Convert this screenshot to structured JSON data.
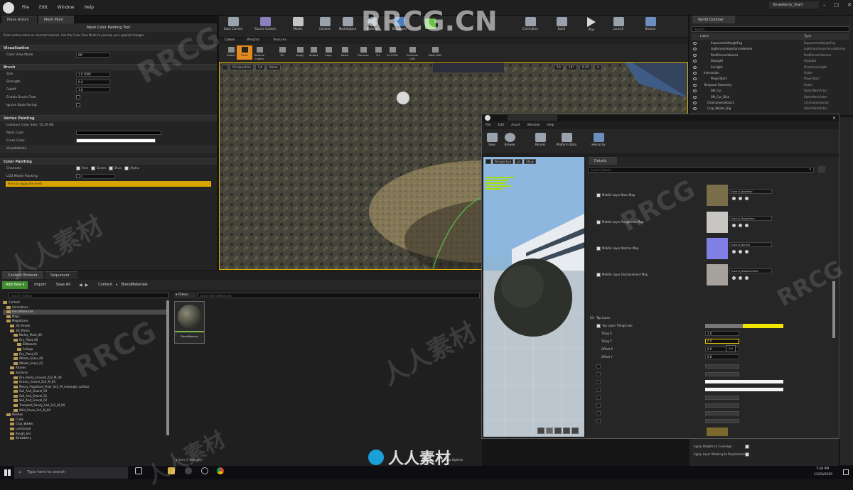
{
  "menubar": {
    "items": [
      "File",
      "Edit",
      "Window",
      "Help"
    ],
    "project": "Strawberry_Start"
  },
  "left_tabs": [
    "Place Actors",
    "Mesh Paint"
  ],
  "toolbar": {
    "buttons": [
      "Save Current",
      "Source Control",
      "Modes",
      "Content",
      "Marketplace",
      "Settings",
      "Blueprints",
      "Cinematics",
      "Build",
      "Play",
      "Launch",
      "Browse"
    ]
  },
  "mesh_paint": {
    "title": "Mesh Color Painting Tool",
    "hint": "Paint vertex colors on selected meshes. Use the Color View Mode to preview your applied changes.",
    "mode_tabs": [
      "Colors",
      "Weights",
      "Textures"
    ],
    "mode_tools": [
      "Select",
      "Paint",
      "Reduce Colors",
      "Fill",
      "Apply",
      "Import",
      "Copy",
      "Paste",
      "Remove",
      "Fix",
      "All LODs",
      "Previous LOD",
      "Next LOD"
    ],
    "sections": {
      "visualization": {
        "label": "Visualization",
        "color_view_mode_label": "Color View Mode",
        "color_view_mode_value": "Off"
      },
      "brush": {
        "label": "Brush",
        "size_label": "Size",
        "size_value": "1.0 1000",
        "strength_label": "Strength",
        "strength_value": "0.4",
        "falloff_label": "Falloff",
        "falloff_value": "1.0",
        "flow_label": "Enable Brush Flow",
        "backface_label": "Ignore Back-Facing"
      },
      "vertex": {
        "label": "Vertex Painting",
        "instance_label": "Instance Color Size: 15.19 KB",
        "paint_color_label": "Paint Color",
        "erase_color_label": "Erase Color",
        "visualization_label": "Visualization"
      },
      "color": {
        "label": "Color Painting",
        "channels_label": "Channels",
        "channels": [
          "Red",
          "Green",
          "Blue",
          "Alpha"
        ],
        "lod_label": "LOD Model Painting",
        "warning": "Press to Apply the mesh"
      }
    }
  },
  "viewport": {
    "buttons": [
      "Perspective",
      "Lit",
      "Show"
    ],
    "snap_values": [
      "10",
      "10°",
      "0.25",
      "4"
    ]
  },
  "outliner": {
    "title": "World Outliner",
    "search_placeholder": "Search...",
    "col_label": "Label",
    "col_type": "Type",
    "items": [
      {
        "name": "ExponentialHeightFog",
        "type": "ExponentialHeightFog",
        "indent": 3
      },
      {
        "name": "LightmassImportanceVolume",
        "type": "LightmassImportanceVolume",
        "indent": 3
      },
      {
        "name": "PostProcessVolume",
        "type": "PostProcessVolume",
        "indent": 3
      },
      {
        "name": "SkyLight",
        "type": "SkyLight",
        "indent": 3
      },
      {
        "name": "Sunlight",
        "type": "DirectionalLight",
        "indent": 3
      },
      {
        "name": "Interaction",
        "type": "Folder",
        "indent": 1
      },
      {
        "name": "PlayerStart",
        "type": "PlayerStart",
        "indent": 3
      },
      {
        "name": "Temporal Geometry",
        "type": "Folder",
        "indent": 1
      },
      {
        "name": "SM_Cyc",
        "type": "StaticMeshActor",
        "indent": 3
      },
      {
        "name": "SM_Cyc_Disk",
        "type": "StaticMeshActor",
        "indent": 3
      },
      {
        "name": "CineCameraActor1",
        "type": "CineCameraActor",
        "indent": 2
      },
      {
        "name": "Crop_Walker_Big",
        "type": "StaticMeshActor",
        "indent": 2
      }
    ]
  },
  "content_browser": {
    "tabs": [
      "Content Browser",
      "Sequencer"
    ],
    "add_new": "Add New",
    "import": "Import",
    "save_all": "Save All",
    "path": [
      "Content",
      "BlendMaterials"
    ],
    "filters": "Filters",
    "search_placeholder": "Search BlendMaterials",
    "tree_search_placeholder": "Search Folders",
    "tree": [
      {
        "name": "Content",
        "indent": 0
      },
      {
        "name": "Animations",
        "indent": 1
      },
      {
        "name": "BlendMaterials",
        "indent": 1
      },
      {
        "name": "Maps",
        "indent": 1
      },
      {
        "name": "MegaScans",
        "indent": 1
      },
      {
        "name": "3D_Assets",
        "indent": 2
      },
      {
        "name": "3D_Plants",
        "indent": 2
      },
      {
        "name": "Barley_Plant_00",
        "indent": 3
      },
      {
        "name": "Dry_Plant_00",
        "indent": 3
      },
      {
        "name": "Billboards",
        "indent": 4
      },
      {
        "name": "Foliage",
        "indent": 4
      },
      {
        "name": "Dry_Plant_01",
        "indent": 3
      },
      {
        "name": "Wheat_Grass_00",
        "indent": 3
      },
      {
        "name": "Wheat_Grass_01",
        "indent": 3
      },
      {
        "name": "Atlases",
        "indent": 2
      },
      {
        "name": "Surfaces",
        "indent": 2
      },
      {
        "name": "Dry_Rocky_Ground_2x2_M_00",
        "indent": 3
      },
      {
        "name": "Grassy_Gravel_2x2_M_00",
        "indent": 3
      },
      {
        "name": "Mossy_Flagstone_Floor_2x2_M_rectangle_surface",
        "indent": 3
      },
      {
        "name": "Soil_And_Gravel_00",
        "indent": 3
      },
      {
        "name": "Soil_And_Gravel_01",
        "indent": 3
      },
      {
        "name": "Soil_And_Gravel_02",
        "indent": 3
      },
      {
        "name": "Trampled_Sandy_Soil_2x2_M_00",
        "indent": 3
      },
      {
        "name": "Wild_Grass_2x2_M_00",
        "indent": 3
      },
      {
        "name": "Meshes",
        "indent": 1
      },
      {
        "name": "Crate",
        "indent": 2
      },
      {
        "name": "Crop_Walker",
        "indent": 2
      },
      {
        "name": "Landscape",
        "indent": 2
      },
      {
        "name": "Rough_Set",
        "indent": 2
      },
      {
        "name": "Strawberry",
        "indent": 2
      }
    ],
    "asset_name": "BlendMaterial",
    "status": "1 item (1 selected)",
    "view_options": "View Options"
  },
  "material_editor": {
    "menu": [
      "File",
      "Edit",
      "Asset",
      "Window",
      "Help"
    ],
    "toolbar": [
      "Save",
      "Browse",
      "Params",
      "Platform Stats",
      "Hierarchy"
    ],
    "preview_buttons": [
      "Perspective",
      "Lit",
      "Show"
    ],
    "details_tab": "Details",
    "details_search_placeholder": "Search Details",
    "textures": [
      {
        "label": "Middle Layer Base Map",
        "name": "Ground_BaseMap"
      },
      {
        "label": "Middle Layer Roughness Map",
        "name": "Ground_Roughness"
      },
      {
        "label": "Middle Layer Normal Map",
        "name": "Ground_Normal"
      },
      {
        "label": "Middle Layer Displacement Map",
        "name": "Ground_Displacement"
      }
    ],
    "top_layer_group": "03 - Top Layer",
    "top_layer_tint": "Top Layer Tiling/Color",
    "tiling": [
      {
        "label": "Tiling X",
        "value": "1.0"
      },
      {
        "label": "Tiling Y",
        "value": "0.5"
      },
      {
        "label": "Offset X",
        "value": "0.0"
      },
      {
        "label": "Offset Y",
        "value": "0.0"
      }
    ],
    "tooltip_value": "0.0",
    "bottom_checkbox_1": "Apply Heights to Coverage",
    "bottom_checkbox_2": "Apply Layer Masking to Displacement"
  },
  "taskbar": {
    "search_placeholder": "Type here to search",
    "time": "7:28 PM",
    "date": "11/25/2020"
  },
  "watermarks": [
    "RRCG",
    "RRCG.CN",
    "人人素材"
  ],
  "colors": {
    "accent_orange": "#e58a1f",
    "warning_yellow": "#d7a300",
    "tint_yellow": "#f0e600",
    "selection": "#e9c400"
  }
}
